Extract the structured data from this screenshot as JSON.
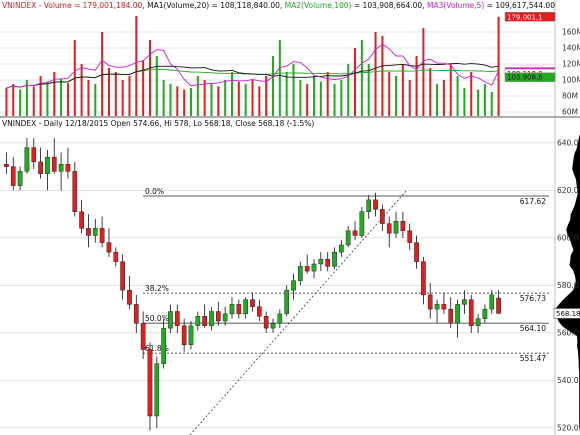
{
  "volume_panel": {
    "series": [
      {
        "name": "VNINDEX - Volume",
        "value": "179,001,184.00",
        "color": "#e02020"
      },
      {
        "name": "MA1(Volume,20)",
        "value": "108,118,840.00",
        "color": "#111111"
      },
      {
        "name": "MA2(Volume,100)",
        "value": "103,908,664.00",
        "color": "#22aa22"
      },
      {
        "name": "MA3(Volume,5)",
        "value": "109,617,544.00",
        "color": "#cc22cc"
      }
    ],
    "axis_ticks": [
      "160M",
      "140M",
      "120M",
      "100M",
      "80M",
      "60M"
    ],
    "axis_values": [
      160,
      140,
      120,
      100,
      80,
      60
    ],
    "tags": [
      {
        "text": "179,001,1",
        "value": 179,
        "bg": "#e02020",
        "fg": "#ffffff"
      },
      {
        "text": "109,617,5",
        "value": 110,
        "bg": "#cc22cc",
        "fg": "#ffffff"
      },
      {
        "text": "108,118,8",
        "value": 108,
        "bg": "#ffffff",
        "fg": "#111111"
      },
      {
        "text": "103,908,6",
        "value": 103.5,
        "bg": "#22aa22",
        "fg": "#111111"
      }
    ]
  },
  "price_panel": {
    "header": "VNINDEX - Daily 12/18/2015 Open 574.66, Hi 578, Lo 568.18, Close 568.18 (-1.5%)",
    "axis_ticks": [
      "640.0",
      "620.0",
      "600.0",
      "580.0",
      "560.0",
      "540.0",
      "520.0"
    ],
    "axis_values": [
      640,
      620,
      600,
      580,
      560,
      540,
      520
    ],
    "last_price_tag": {
      "text": "568.18",
      "value": 568.18
    },
    "fib_levels": [
      {
        "pct": "0.0%",
        "price_label": "617.62",
        "value": 617.62,
        "style": "solid"
      },
      {
        "pct": "38.2%",
        "price_label": "576.73",
        "value": 576.73,
        "style": "dashed"
      },
      {
        "pct": "50.0%",
        "price_label": "564.10",
        "value": 564.1,
        "style": "solid"
      },
      {
        "pct": "61.8%",
        "price_label": "551.47",
        "value": 551.47,
        "style": "dashed"
      }
    ]
  },
  "chart_data": {
    "type": "candlestick",
    "title": "VNINDEX - Daily 12/18/2015 Open 574.66, Hi 578, Lo 568.18, Close 568.18 (-1.5%)",
    "ylim_price": [
      517,
      645
    ],
    "ylim_volume": [
      55,
      185
    ],
    "last_bar": {
      "open": 574.66,
      "high": 578,
      "low": 568.18,
      "close": 568.18,
      "change": "-1.5%"
    },
    "candles": [
      [
        631.0,
        636.0,
        627.0,
        630.0
      ],
      [
        630.0,
        634.0,
        620.0,
        622.0
      ],
      [
        622.0,
        630.0,
        620.0,
        628.0
      ],
      [
        628.0,
        642.0,
        627.0,
        638.0
      ],
      [
        638.0,
        642.0,
        629.0,
        632.0
      ],
      [
        632.0,
        638.0,
        625.0,
        627.0
      ],
      [
        627.0,
        637.0,
        620.0,
        634.0
      ],
      [
        634.0,
        642.0,
        627.0,
        628.0
      ],
      [
        628.0,
        636.0,
        620.0,
        631.0
      ],
      [
        631.0,
        638.0,
        625.0,
        628.0
      ],
      [
        628.0,
        632.0,
        609.0,
        611.0
      ],
      [
        611.0,
        616.0,
        602.0,
        604.0
      ],
      [
        604.0,
        610.0,
        596.0,
        601.0
      ],
      [
        601.0,
        608.0,
        598.0,
        604.0
      ],
      [
        604.0,
        609.0,
        596.0,
        598.0
      ],
      [
        598.0,
        604.0,
        592.0,
        594.0
      ],
      [
        594.0,
        596.0,
        588.0,
        590.0
      ],
      [
        590.0,
        593.0,
        574.0,
        578.0
      ],
      [
        578.0,
        584.0,
        570.0,
        572.0
      ],
      [
        572.0,
        576.0,
        560.0,
        564.0
      ],
      [
        564.0,
        569.0,
        549.0,
        553.0
      ],
      [
        553.0,
        556.0,
        519.0,
        525.0
      ],
      [
        525.0,
        550.0,
        520.0,
        547.0
      ],
      [
        547.0,
        566.0,
        545.0,
        562.0
      ],
      [
        562.0,
        572.0,
        560.0,
        569.0
      ],
      [
        569.0,
        572.0,
        560.0,
        563.0
      ],
      [
        563.0,
        566.0,
        552.0,
        555.0
      ],
      [
        555.0,
        565.0,
        553.0,
        563.0
      ],
      [
        563.0,
        569.0,
        561.0,
        567.0
      ],
      [
        567.0,
        572.0,
        562.0,
        563.0
      ],
      [
        563.0,
        571.0,
        561.0,
        569.0
      ],
      [
        569.0,
        573.0,
        563.0,
        565.0
      ],
      [
        565.0,
        571.0,
        563.0,
        568.0
      ],
      [
        568.0,
        575.0,
        566.0,
        572.0
      ],
      [
        572.0,
        574.0,
        566.0,
        568.0
      ],
      [
        568.0,
        575.0,
        566.0,
        574.0
      ],
      [
        574.0,
        577.0,
        569.0,
        571.0
      ],
      [
        571.0,
        574.0,
        565.0,
        567.0
      ],
      [
        567.0,
        569.0,
        560.0,
        562.0
      ],
      [
        562.0,
        566.0,
        560.0,
        564.0
      ],
      [
        564.0,
        570.0,
        562.0,
        568.0
      ],
      [
        568.0,
        580.0,
        567.0,
        578.0
      ],
      [
        578.0,
        585.0,
        574.0,
        582.0
      ],
      [
        582.0,
        590.0,
        580.0,
        588.0
      ],
      [
        588.0,
        593.0,
        585.0,
        586.0
      ],
      [
        586.0,
        591.0,
        583.0,
        589.0
      ],
      [
        589.0,
        594.0,
        586.0,
        591.0
      ],
      [
        591.0,
        594.0,
        586.0,
        588.0
      ],
      [
        588.0,
        596.0,
        587.0,
        594.0
      ],
      [
        594.0,
        599.0,
        592.0,
        597.0
      ],
      [
        597.0,
        605.0,
        596.0,
        603.0
      ],
      [
        603.0,
        607.0,
        599.0,
        601.0
      ],
      [
        601.0,
        613.0,
        600.0,
        611.0
      ],
      [
        611.0,
        618.0,
        608.0,
        616.0
      ],
      [
        616.0,
        619.0,
        609.0,
        612.0
      ],
      [
        612.0,
        614.0,
        603.0,
        606.0
      ],
      [
        606.0,
        609.0,
        596.0,
        602.0
      ],
      [
        602.0,
        611.0,
        600.0,
        607.0
      ],
      [
        607.0,
        611.0,
        600.0,
        603.0
      ],
      [
        603.0,
        606.0,
        595.0,
        598.0
      ],
      [
        598.0,
        601.0,
        587.0,
        590.0
      ],
      [
        590.0,
        592.0,
        572.0,
        576.0
      ],
      [
        576.0,
        581.0,
        566.0,
        570.0
      ],
      [
        570.0,
        574.0,
        564.0,
        572.0
      ],
      [
        572.0,
        577.0,
        568.0,
        570.0
      ],
      [
        570.0,
        575.0,
        562.0,
        564.0
      ],
      [
        564.0,
        574.0,
        558.0,
        572.0
      ],
      [
        572.0,
        578.0,
        568.0,
        574.0
      ],
      [
        574.0,
        576.0,
        560.0,
        563.0
      ],
      [
        563.0,
        568.0,
        560.0,
        566.0
      ],
      [
        566.0,
        572.0,
        564.0,
        570.0
      ],
      [
        570.0,
        578.0,
        568.0,
        576.0
      ],
      [
        574.66,
        578.0,
        568.18,
        568.18
      ]
    ],
    "volume_millions": [
      90,
      95,
      88,
      100,
      92,
      105,
      98,
      110,
      102,
      96,
      150,
      120,
      100,
      95,
      160,
      115,
      110,
      100,
      105,
      180,
      125,
      150,
      130,
      100,
      95,
      92,
      88,
      90,
      105,
      100,
      95,
      92,
      100,
      110,
      98,
      95,
      100,
      92,
      105,
      130,
      150,
      110,
      120,
      100,
      95,
      105,
      98,
      110,
      95,
      100,
      120,
      140,
      150,
      120,
      160,
      155,
      110,
      105,
      120,
      100,
      130,
      165,
      115,
      95,
      100,
      120,
      105,
      90,
      110,
      88,
      95,
      85,
      179
    ]
  },
  "colors": {
    "up": "#22aa22",
    "down": "#e02020",
    "wick": "#111111",
    "ma20": "#111111",
    "ma100": "#22aa22",
    "ma5": "#cc22cc",
    "profile": "#000000",
    "grid": "#c8c8c8"
  }
}
